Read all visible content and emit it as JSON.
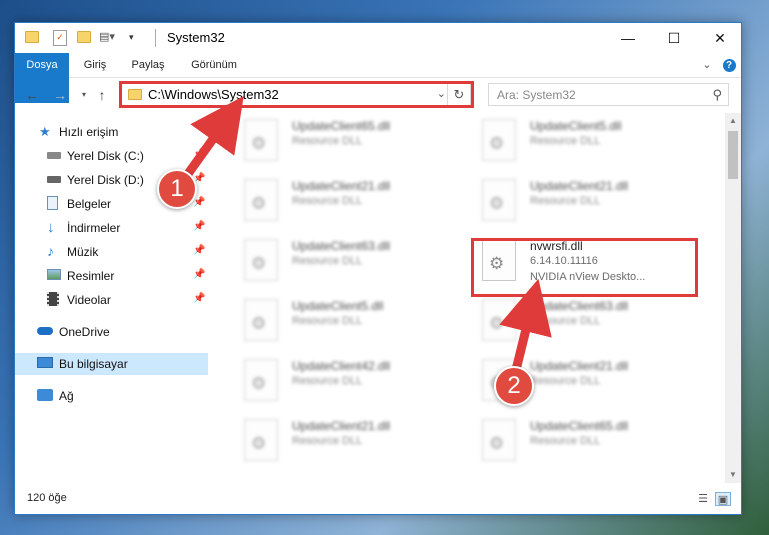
{
  "window": {
    "title": "System32",
    "controls": {
      "minimize": "—",
      "maximize": "☐",
      "close": "✕"
    }
  },
  "ribbon": {
    "tabs": [
      "Dosya",
      "Giriş",
      "Paylaş",
      "Görünüm"
    ],
    "expand": "⌄",
    "help": "?"
  },
  "nav": {
    "address": "C:\\Windows\\System32",
    "search_placeholder": "Ara: System32"
  },
  "sidebar": {
    "items": [
      {
        "label": "Hızlı erişim",
        "icon": "star-icon"
      },
      {
        "label": "Yerel Disk (C:)",
        "icon": "drive-icon"
      },
      {
        "label": "Yerel Disk (D:)",
        "icon": "drive-icon"
      },
      {
        "label": "Belgeler",
        "icon": "documents-icon"
      },
      {
        "label": "İndirmeler",
        "icon": "download-icon"
      },
      {
        "label": "Müzik",
        "icon": "music-icon"
      },
      {
        "label": "Resimler",
        "icon": "pictures-icon"
      },
      {
        "label": "Videolar",
        "icon": "video-icon"
      },
      {
        "label": "OneDrive",
        "icon": "cloud-icon"
      },
      {
        "label": "Bu bilgisayar",
        "icon": "computer-icon"
      },
      {
        "label": "Ağ",
        "icon": "network-icon"
      }
    ]
  },
  "files": [
    {
      "name": "UpdateClient65.dll",
      "type": "Resource DLL"
    },
    {
      "name": "UpdateClient5.dll",
      "type": "Resource DLL"
    },
    {
      "name": "UpdateClient21.dll",
      "type": "Resource DLL"
    },
    {
      "name": "UpdateClient21.dll",
      "type": "Resource DLL"
    },
    {
      "name": "UpdateClient63.dll",
      "type": "Resource DLL"
    },
    {
      "name": "nvwrsfi.dll",
      "version": "6.14.10.11116",
      "description": "NVIDIA nView Deskto..."
    },
    {
      "name": "UpdateClient5.dll",
      "type": "Resource DLL"
    },
    {
      "name": "UpdateClient63.dll",
      "type": "Resource DLL"
    },
    {
      "name": "UpdateClient42.dll",
      "type": "Resource DLL"
    },
    {
      "name": "UpdateClient21.dll",
      "type": "Resource DLL"
    },
    {
      "name": "UpdateClient21.dll",
      "type": "Resource DLL"
    },
    {
      "name": "UpdateClient65.dll",
      "type": "Resource DLL"
    }
  ],
  "status": {
    "count": "120 öğe"
  },
  "annotations": {
    "step1": "1",
    "step2": "2",
    "color": "#df3b3b"
  }
}
